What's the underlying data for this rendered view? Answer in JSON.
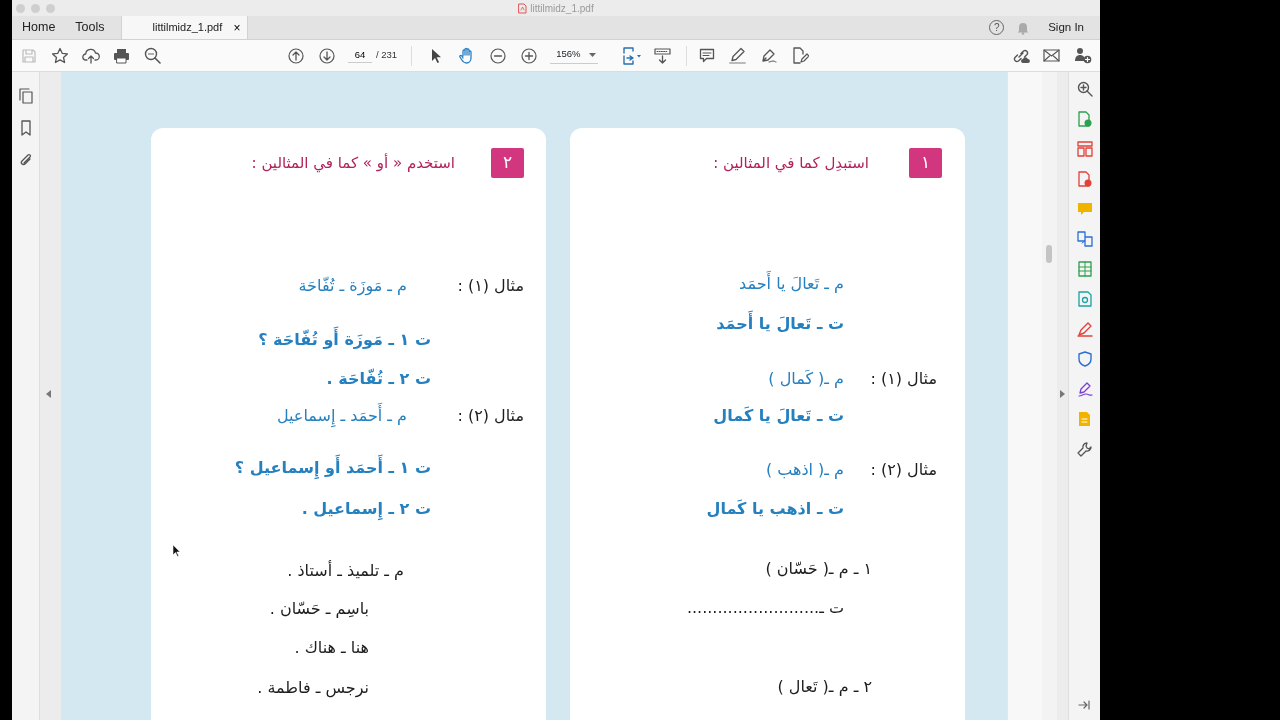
{
  "window": {
    "title": "littilmidz_1.pdf"
  },
  "home_tab": {
    "label": "Home",
    "selected": false
  },
  "tools_tab": {
    "label": "Tools",
    "selected": false
  },
  "document_tab": {
    "label": "littilmidz_1.pdf",
    "selected": true,
    "close": "×"
  },
  "header_actions": {
    "help": "?",
    "sign_in": "Sign In"
  },
  "toolbar": {
    "page": "64",
    "page_total": "/ 231",
    "zoom": "156%",
    "tools": [
      {
        "kind": "select",
        "selected": false
      },
      {
        "kind": "hand",
        "selected": true
      }
    ]
  },
  "document": {
    "cards": [
      {
        "number": "١",
        "title": "استبدِل كما في المثالين :",
        "lines": [
          {
            "kind": "prompt",
            "text": "م ـ تَعالَ يا أَحمَد"
          },
          {
            "kind": "answer",
            "text": "ت ـ تَعالَ يا أَحمَد"
          },
          {
            "kind": "prompt",
            "label": "مثال (١) :",
            "text": "م ـ( كَمال )"
          },
          {
            "kind": "answer",
            "text": "ت ـ تَعالَ يا كَمال"
          },
          {
            "kind": "prompt",
            "label": "مثال (٢) :",
            "text": "م ـ( اذهب )"
          },
          {
            "kind": "answer",
            "text": "ت ـ اذهب يا كَمال"
          },
          {
            "kind": "exercise",
            "text": "١ ـ م ـ( حَسّان )"
          },
          {
            "kind": "blank",
            "text": "ت ـ.........................."
          },
          {
            "kind": "exercise",
            "text": "٢ ـ م ـ( تَعال )"
          }
        ]
      },
      {
        "number": "٢",
        "title": "استخدم « أو » كما في المثالين :",
        "lines": [
          {
            "kind": "prompt",
            "label": "مثال (١) :",
            "text": "م ـ مَوزَة ـ تُفّاحَة"
          },
          {
            "kind": "answer",
            "text": "ت ١ ـ مَوزَة أَو تُفّاحَة ؟"
          },
          {
            "kind": "answer",
            "text": "ت ٢ ـ تُفّاحَة ."
          },
          {
            "kind": "prompt",
            "label": "مثال (٢) :",
            "text": "م ـ أَحمَد ـ إِسماعيل"
          },
          {
            "kind": "answer",
            "text": "ت ١ ـ أَحمَد أَو إِسماعيل ؟"
          },
          {
            "kind": "answer",
            "text": "ت ٢ ـ إِسماعيل ."
          },
          {
            "kind": "exercise",
            "text": "م ـ تلميذ ـ أستاذ ."
          },
          {
            "kind": "continuation",
            "text": "باسِم ـ حَسّان ."
          },
          {
            "kind": "continuation",
            "text": "هنا ـ هناك ."
          },
          {
            "kind": "continuation",
            "text": "نرجس ـ فاطمة ."
          }
        ]
      }
    ]
  }
}
